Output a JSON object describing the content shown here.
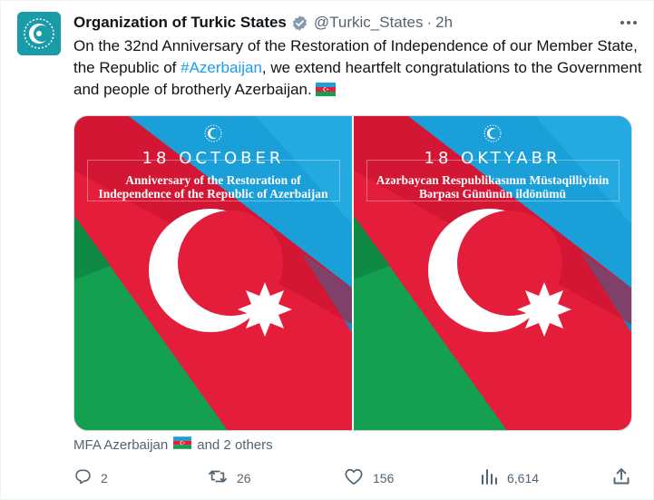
{
  "tweet": {
    "author_name": "Organization of Turkic States",
    "handle": "@Turkic_States",
    "separator": "·",
    "time": "2h",
    "text_before_hashtag": "On the 32nd Anniversary of the Restoration of Independence of our Member State, the Republic of ",
    "hashtag": "#Azerbaijan",
    "text_after_hashtag": ", we extend heartfelt congratulations to the Government and people of brotherly Azerbaijan.",
    "media": [
      {
        "date": "18 OCTOBER",
        "subtitle": "Anniversary of the Restoration of Independence of the Republic of Azerbaijan"
      },
      {
        "date": "18 OKTYABR",
        "subtitle": "Azərbaycan Respublikasının Müstəqilliyinin Bərpası Gününün ildönümü"
      }
    ],
    "tagged_first": "MFA Azerbaijan",
    "tagged_rest": "and 2 others",
    "actions": {
      "replies": "2",
      "retweets": "26",
      "likes": "156",
      "views": "6,614"
    }
  },
  "colors": {
    "flag_blue": "#1a9fd8",
    "flag_red": "#e41e3a",
    "flag_green": "#13a050",
    "brand_teal": "#1a9ca8",
    "link_blue": "#1d9bf0",
    "verified_gray": "#829aab",
    "muted_text": "#536471"
  },
  "icons": [
    "avatar-logo",
    "verified-badge-icon",
    "more-icon",
    "azerbaijan-flag-emoji",
    "reply-icon",
    "retweet-icon",
    "like-icon",
    "views-icon",
    "share-icon"
  ]
}
